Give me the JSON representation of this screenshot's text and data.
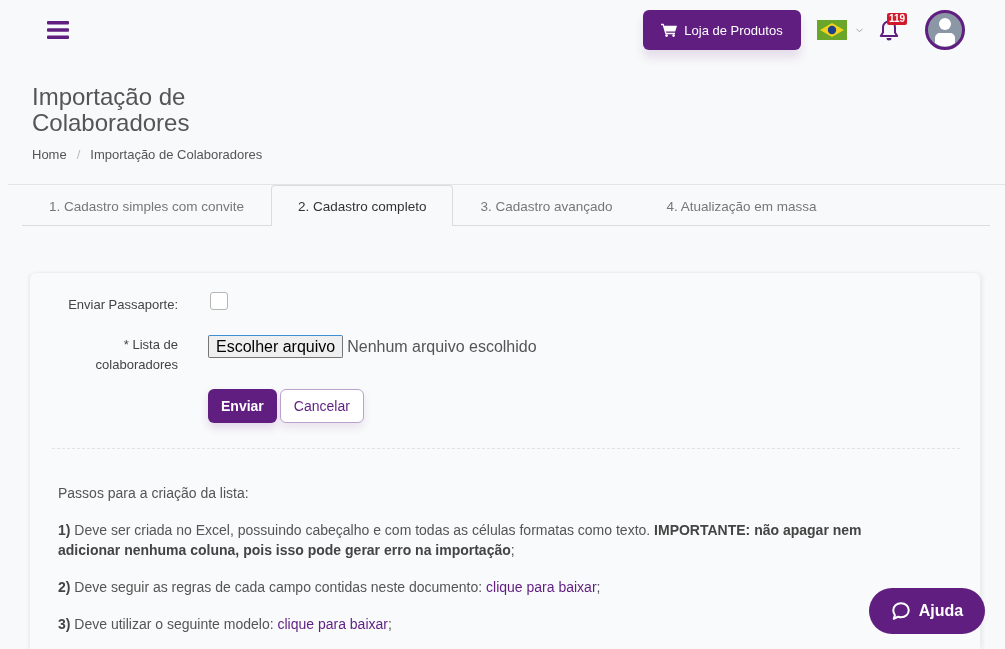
{
  "header": {
    "store_button": "Loja de Produtos",
    "notification_count": "119"
  },
  "page_title": "Importação de Colaboradores",
  "breadcrumb": {
    "items": [
      {
        "label": "Home"
      },
      {
        "label": "Importação de Colaboradores"
      }
    ],
    "separator": "/"
  },
  "tabs": [
    {
      "label": "1. Cadastro simples com convite",
      "selected": false
    },
    {
      "label": "2. Cadastro completo",
      "selected": true
    },
    {
      "label": "3. Cadastro avançado",
      "selected": false
    },
    {
      "label": "4. Atualização em massa",
      "selected": false
    }
  ],
  "form": {
    "fields": [
      {
        "kind": "checkbox",
        "label": "Enviar Passaporte:",
        "checked": false
      },
      {
        "kind": "file",
        "label": "* Lista de colaboradores",
        "button": "Escolher arquivo",
        "status": "Nenhum arquivo escolhido"
      }
    ],
    "buttons": [
      {
        "kind": "primary",
        "label": "Enviar"
      },
      {
        "kind": "secondary",
        "label": "Cancelar"
      }
    ]
  },
  "instructions": {
    "intro": "Passos para a criação da lista:",
    "steps": [
      {
        "text": "**1)** Deve ser criada no Excel, possuindo cabeçalho e com todas as células formatas como texto. **IMPORTANTE: não apagar nem adicionar nenhuma coluna, pois isso pode gerar erro na importação**;"
      },
      {
        "text": "**2)** Deve seguir as regras de cada campo contidas neste documento:",
        "link": "clique para baixar",
        "suffix": ";"
      },
      {
        "text": "**3)** Deve utilizar o seguinte modelo:",
        "link": "clique para baixar",
        "suffix": ";"
      }
    ]
  },
  "help_button": "Ajuda"
}
